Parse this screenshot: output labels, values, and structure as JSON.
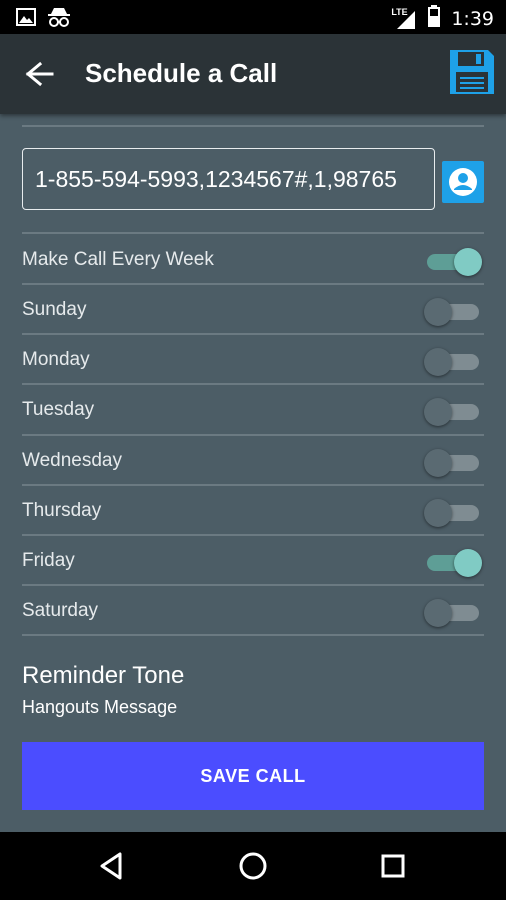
{
  "status_bar": {
    "time": "1:39",
    "network": "LTE",
    "icons": [
      "image-icon",
      "incognito-icon",
      "signal-icon",
      "battery-icon"
    ]
  },
  "app_bar": {
    "title": "Schedule a Call",
    "back_icon": "arrow-back-icon",
    "save_icon": "floppy-disk-icon"
  },
  "phone": {
    "value": "1-855-594-5993,1234567#,1,98765"
  },
  "contact_button": {
    "icon": "contact-icon"
  },
  "weekly": {
    "label": "Make Call Every Week",
    "on": true
  },
  "days": [
    {
      "label": "Sunday",
      "on": false
    },
    {
      "label": "Monday",
      "on": false
    },
    {
      "label": "Tuesday",
      "on": false
    },
    {
      "label": "Wednesday",
      "on": false
    },
    {
      "label": "Thursday",
      "on": false
    },
    {
      "label": "Friday",
      "on": true
    },
    {
      "label": "Saturday",
      "on": false
    }
  ],
  "reminder": {
    "title": "Reminder Tone",
    "value": "Hangouts Message"
  },
  "save_button": {
    "label": "SAVE CALL"
  },
  "colors": {
    "app_bar": "#2b3337",
    "content_bg": "#4c5d66",
    "accent_blue": "#1ea1e8",
    "save_button": "#4b4dff",
    "switch_on": "#80cbc4"
  },
  "nav_bar": {
    "icons": [
      "back-triangle-icon",
      "home-circle-icon",
      "recents-square-icon"
    ]
  }
}
